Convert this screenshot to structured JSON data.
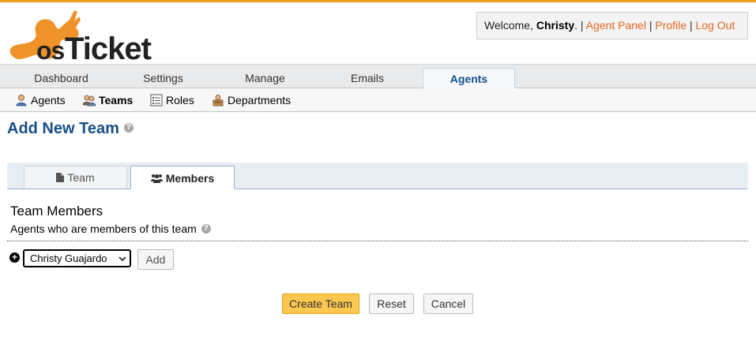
{
  "header": {
    "logo_text": "osTicket",
    "welcome_prefix": "Welcome, ",
    "user_name": "Christy",
    "welcome_suffix": ".",
    "links": [
      "Agent Panel",
      "Profile",
      "Log Out"
    ],
    "separator": "|"
  },
  "nav": {
    "tabs": [
      "Dashboard",
      "Settings",
      "Manage",
      "Emails",
      "Agents"
    ],
    "active": "Agents"
  },
  "subnav": {
    "items": [
      "Agents",
      "Teams",
      "Roles",
      "Departments"
    ],
    "active": "Teams"
  },
  "page": {
    "title": "Add New Team"
  },
  "form_tabs": {
    "team": "Team",
    "members": "Members",
    "active": "Members"
  },
  "section": {
    "title": "Team Members",
    "subtitle": "Agents who are members of this team"
  },
  "member_add": {
    "selected_agent": "Christy Guajardo",
    "add_label": "Add"
  },
  "actions": {
    "create": "Create Team",
    "reset": "Reset",
    "cancel": "Cancel"
  },
  "colors": {
    "accent_orange": "#e5661f",
    "title_blue": "#184e87",
    "create_button": "#fbc74e"
  },
  "icons": {
    "help": "help-circle-icon",
    "team_tab": "document-icon",
    "members_tab": "users-icon",
    "add_row": "plus-circle-icon"
  }
}
